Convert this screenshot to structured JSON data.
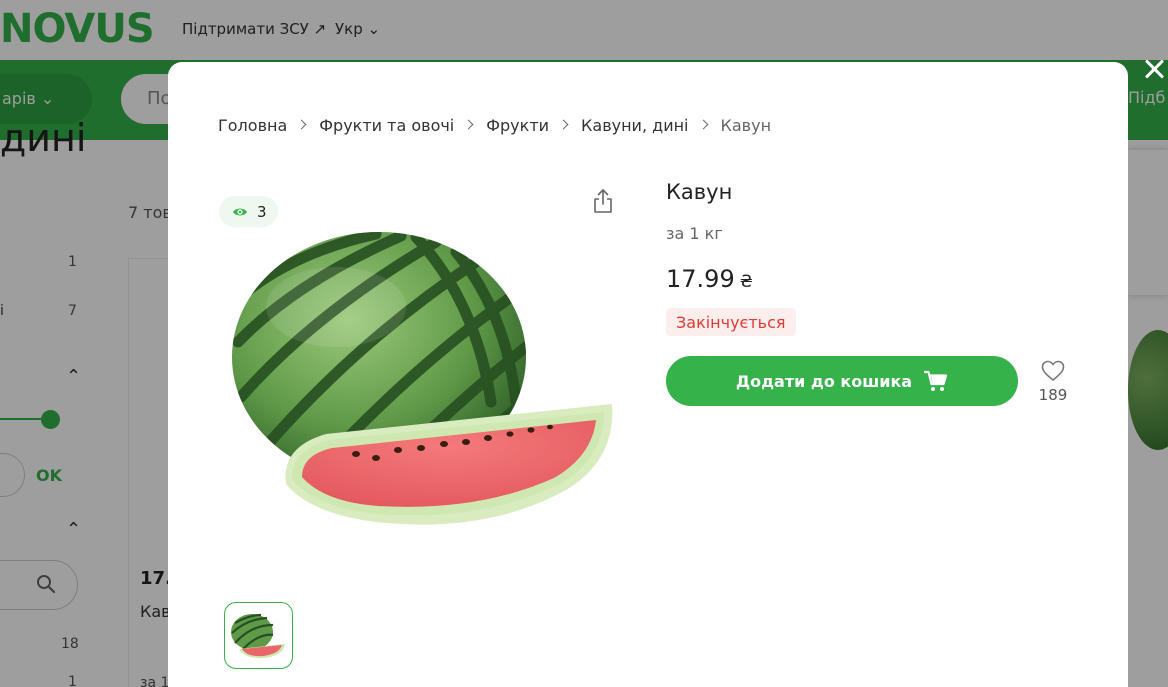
{
  "background": {
    "logo": "NOVUS",
    "support_link": "Підтримати ЗСУ ↗",
    "language": "Укр ⌄",
    "catalog_button": "арів ⌄",
    "search_placeholder": "По",
    "right_label": "Підб",
    "heading": "дині",
    "product_count": "7 тов",
    "filter_numbers": [
      "1",
      "7",
      "18",
      "1"
    ],
    "filter_label": "і",
    "ok_label": "OK",
    "card": {
      "price": "17.",
      "name": "Кав",
      "unit": "за 1"
    },
    "colors": {
      "brand": "#35b24a"
    }
  },
  "modal": {
    "breadcrumb": [
      "Головна",
      "Фрукти та овочі",
      "Фрукти",
      "Кавуни, дині",
      "Кавун"
    ],
    "views_count": "3",
    "product": {
      "title": "Кавун",
      "unit": "за 1 кг",
      "price": "17.99",
      "currency": "₴",
      "stock_status": "Закінчується"
    },
    "add_to_cart_label": "Додати до кошика",
    "favorites_count": "189",
    "colors": {
      "accent": "#35b24a",
      "stock_text": "#e53935",
      "stock_bg": "#fdeeee",
      "badge_bg": "#eef8f0"
    },
    "icons": [
      "eye-icon",
      "share-icon",
      "cart-icon",
      "heart-icon",
      "close-icon"
    ]
  }
}
